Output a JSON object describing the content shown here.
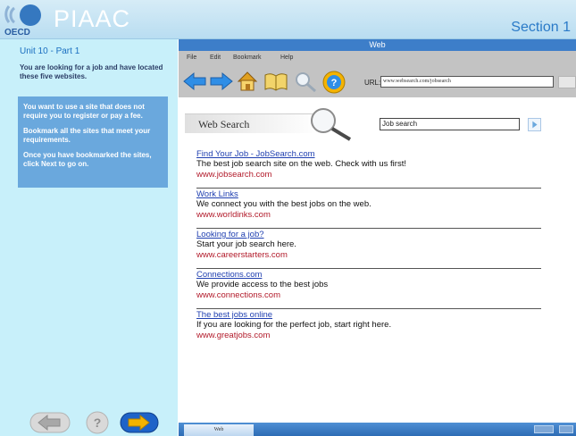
{
  "header": {
    "brand": "PIAAC",
    "logo_text": "OECD",
    "section": "Section 1"
  },
  "left_panel": {
    "unit": "Unit 10 - Part 1",
    "intro": "You are looking for a job and have located these five websites.",
    "tasks": [
      "You want to use a site that does not require you to register or pay a fee.",
      "Bookmark all the sites that meet your requirements.",
      "Once you have bookmarked the sites, click Next to go on."
    ]
  },
  "navigation": {
    "back_icon": "back-arrow-icon",
    "help_icon": "help-icon",
    "next_icon": "next-arrow-icon"
  },
  "browser": {
    "title": "Web",
    "menu": [
      "File",
      "Edit",
      "Bookmark",
      "Help"
    ],
    "toolbar_icons": [
      "back-arrow-icon",
      "forward-arrow-icon",
      "home-icon",
      "bookmark-book-icon",
      "search-icon",
      "help-icon"
    ],
    "url_label": "URL:",
    "url_value": "www.websearch.com/jobsearch",
    "search_heading": "Web Search",
    "search_value": "Job search",
    "results": [
      {
        "title": "Find Your Job - JobSearch.com",
        "desc": "The best job search site on the web.  Check with us first!",
        "url": "www.jobsearch.com"
      },
      {
        "title": "Work Links",
        "desc": "We connect you with the best jobs on the web.",
        "url": "www.worldinks.com"
      },
      {
        "title": "Looking for a job?",
        "desc": "Start your job search here.",
        "url": "www.careerstarters.com"
      },
      {
        "title": "Connections.com",
        "desc": "We provide access to the best jobs",
        "url": "www.connections.com"
      },
      {
        "title": "The best jobs online",
        "desc": "If you are looking for the perfect job, start right here.",
        "url": "www.greatjobs.com"
      }
    ],
    "status_tab": "Web"
  },
  "colors": {
    "header_bg": "#c5e4f5",
    "left_panel_bg": "#c8f0fa",
    "task_box_bg": "#6aa8dd",
    "browser_title_bg": "#3d7ec9",
    "toolbar_bg": "#c3c3c3",
    "link": "#1f3fb0",
    "result_url": "#b21a2a",
    "nav_next": "#1e63c8",
    "arrow_yellow": "#f4b300"
  }
}
